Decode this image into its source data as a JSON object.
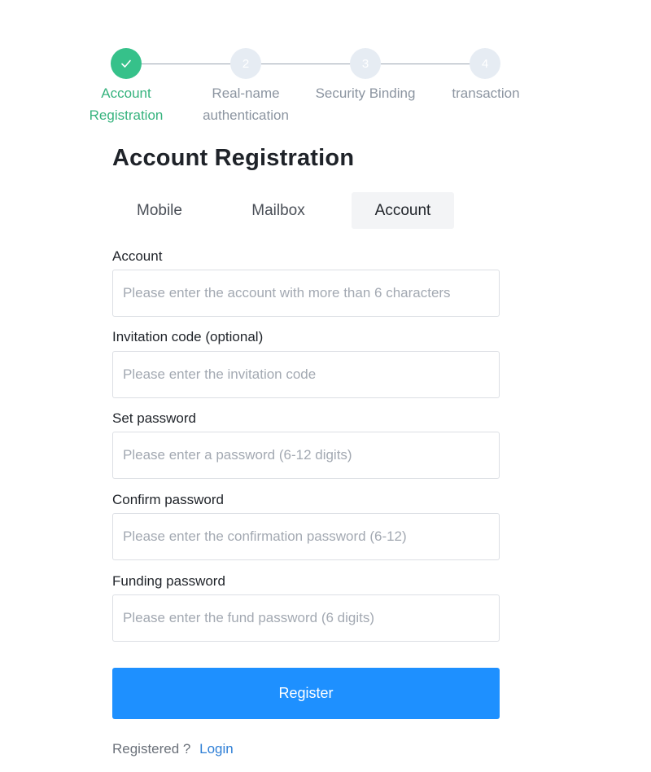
{
  "steps": [
    {
      "number": "",
      "label_line1": "Account",
      "label_line2": "Registration",
      "state": "done",
      "icon": "check-icon"
    },
    {
      "number": "2",
      "label_line1": "Real-name",
      "label_line2": "authentication",
      "state": "pending"
    },
    {
      "number": "3",
      "label_line1": "Security Binding",
      "label_line2": "",
      "state": "pending"
    },
    {
      "number": "4",
      "label_line1": "transaction",
      "label_line2": "",
      "state": "pending"
    }
  ],
  "page_title": "Account Registration",
  "tabs": [
    {
      "label": "Mobile",
      "active": false
    },
    {
      "label": "Mailbox",
      "active": false
    },
    {
      "label": "Account",
      "active": true
    }
  ],
  "form": {
    "account": {
      "label": "Account",
      "placeholder": "Please enter the account with more than 6 characters",
      "value": ""
    },
    "invitation": {
      "label": "Invitation code (optional)",
      "placeholder": "Please enter the invitation code",
      "value": ""
    },
    "password": {
      "label": "Set password",
      "placeholder": "Please enter a password (6-12 digits)",
      "value": ""
    },
    "confirm": {
      "label": "Confirm password",
      "placeholder": "Please enter the confirmation password (6-12)",
      "value": ""
    },
    "funding": {
      "label": "Funding password",
      "placeholder": "Please enter the fund password (6 digits)",
      "value": ""
    }
  },
  "register_label": "Register",
  "footer": {
    "registered_text": "Registered ?",
    "login_label": "Login"
  },
  "colors": {
    "accent": "#1e90ff",
    "success": "#36c18a",
    "step_pending": "#e6ecf3"
  }
}
